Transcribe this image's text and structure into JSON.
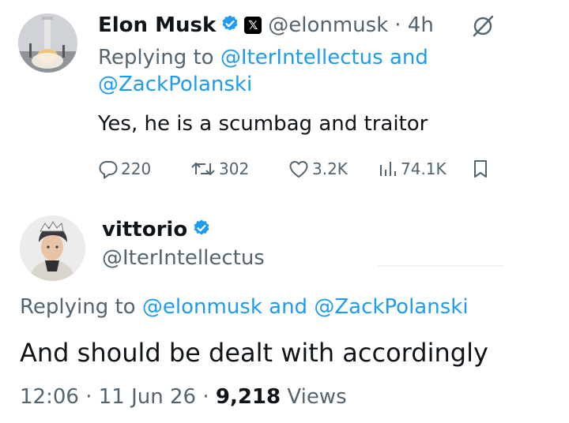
{
  "tweet1": {
    "name": "Elon Musk",
    "handle": "@elonmusk",
    "time": "· 4h",
    "reply_prefix": "Replying to",
    "reply_handle1": "@IterIntellectus",
    "reply_and": "and",
    "reply_handle2": "@ZackPolanski",
    "text": "Yes, he is a scumbag and traitor",
    "stats": {
      "replies": "220",
      "reposts": "302",
      "likes": "3.2K",
      "views": "74.1K"
    }
  },
  "tweet2": {
    "name": "vittorio",
    "handle": "@IterIntellectus",
    "reply_prefix": "Replying to",
    "reply_handle1": "@elonmusk",
    "reply_and": "and",
    "reply_handle2": "@ZackPolanski",
    "text": "And should be dealt with accordingly",
    "time": "12:06",
    "date": "11 Jun 26",
    "views_count": "9,218",
    "views_label": "Views"
  },
  "colors": {
    "link": "#1d9bf0",
    "secondary_text": "#536471",
    "primary_text": "#0f1419",
    "verified": "#1d9bf0"
  },
  "icons": {
    "verified": "verified-badge-icon",
    "affiliate": "x-logo-icon",
    "mute": "mute-icon",
    "reply": "reply-icon",
    "repost": "repost-icon",
    "like": "heart-icon",
    "views": "views-chart-icon",
    "bookmark": "bookmark-icon"
  }
}
